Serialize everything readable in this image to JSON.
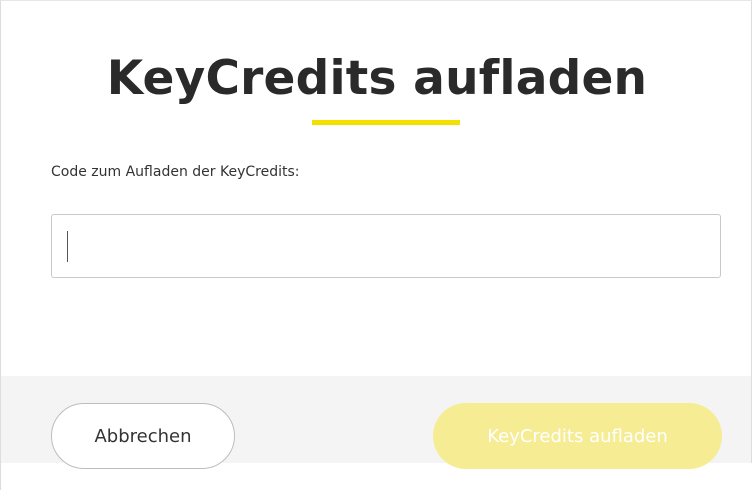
{
  "dialog": {
    "title": "KeyCredits aufladen",
    "accent_color": "#f3e000",
    "field_label": "Code zum Aufladen der KeyCredits:",
    "code_input": {
      "value": "",
      "placeholder": ""
    },
    "buttons": {
      "cancel_label": "Abbrechen",
      "submit_label": "KeyCredits aufladen",
      "submit_enabled": false,
      "submit_color": "#f6ec94"
    }
  }
}
